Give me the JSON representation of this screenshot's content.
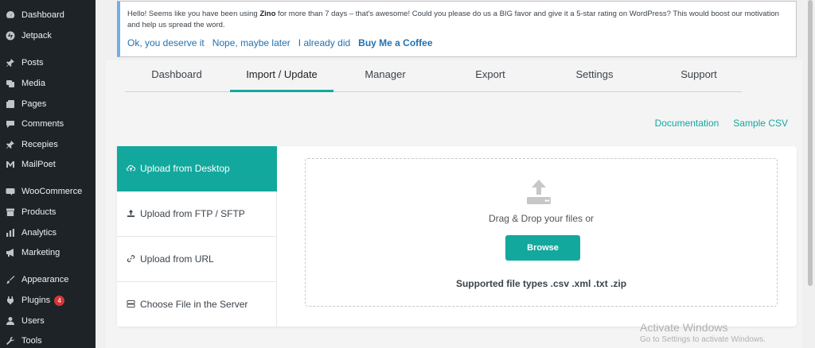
{
  "sidebar": {
    "items": [
      {
        "label": "Dashboard",
        "icon": "dashboard-icon"
      },
      {
        "label": "Jetpack",
        "icon": "jetpack-icon"
      },
      {
        "label": "Posts",
        "icon": "pin-icon"
      },
      {
        "label": "Media",
        "icon": "media-icon"
      },
      {
        "label": "Pages",
        "icon": "pages-icon"
      },
      {
        "label": "Comments",
        "icon": "comment-icon"
      },
      {
        "label": "Recepies",
        "icon": "pin-icon"
      },
      {
        "label": "MailPoet",
        "icon": "mailpoet-icon"
      },
      {
        "label": "WooCommerce",
        "icon": "woocommerce-icon"
      },
      {
        "label": "Products",
        "icon": "archive-icon"
      },
      {
        "label": "Analytics",
        "icon": "chart-icon"
      },
      {
        "label": "Marketing",
        "icon": "megaphone-icon"
      },
      {
        "label": "Appearance",
        "icon": "brush-icon"
      },
      {
        "label": "Plugins",
        "icon": "plugin-icon",
        "badge": "4"
      },
      {
        "label": "Users",
        "icon": "user-icon"
      },
      {
        "label": "Tools",
        "icon": "wrench-icon"
      }
    ]
  },
  "notice": {
    "text_before": "Hello! Seems like you have been using ",
    "text_bold": "Zino",
    "text_after": " for more than 7 days – that's awesome! Could you please do us a BIG favor and give it a 5-star rating on WordPress? This would boost our motivation and help us spread the word.",
    "links": [
      "Ok, you deserve it",
      "Nope, maybe later",
      "I already did",
      "Buy Me a Coffee"
    ]
  },
  "tabs": [
    "Dashboard",
    "Import / Update",
    "Manager",
    "Export",
    "Settings",
    "Support"
  ],
  "active_tab": "Import / Update",
  "doc_links": [
    "Documentation",
    "Sample CSV"
  ],
  "upload_options": [
    {
      "label": "Upload from Desktop",
      "icon": "cloud-upload-icon"
    },
    {
      "label": "Upload from FTP / SFTP",
      "icon": "upload-tray-icon"
    },
    {
      "label": "Upload from URL",
      "icon": "link-icon"
    },
    {
      "label": "Choose File in the Server",
      "icon": "server-icon"
    }
  ],
  "dropzone": {
    "drag_text": "Drag & Drop your files or",
    "browse_label": "Browse",
    "supported_types": "Supported file types .csv .xml .txt .zip"
  },
  "watermark": {
    "line1": "Activate Windows",
    "line2": "Go to Settings to activate Windows."
  },
  "colors": {
    "accent": "#13a89e",
    "sidebar_bg": "#1d2327",
    "link_blue": "#2271b1",
    "notice_border": "#72aee6",
    "badge_red": "#d63638"
  }
}
